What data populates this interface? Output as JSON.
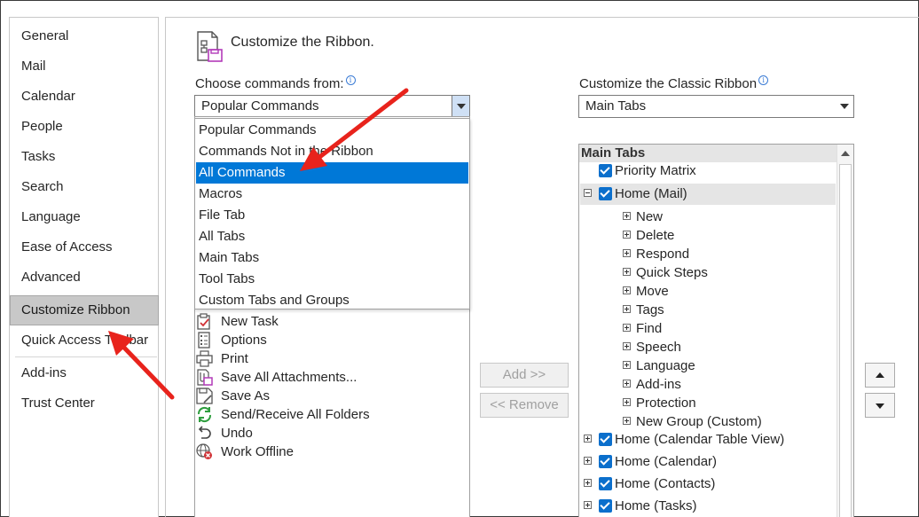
{
  "sidebar": {
    "items": [
      {
        "label": "General"
      },
      {
        "label": "Mail"
      },
      {
        "label": "Calendar"
      },
      {
        "label": "People"
      },
      {
        "label": "Tasks"
      },
      {
        "label": "Search"
      },
      {
        "label": "Language"
      },
      {
        "label": "Ease of Access"
      },
      {
        "label": "Advanced"
      },
      {
        "label": "Customize Ribbon"
      },
      {
        "label": "Quick Access Toolbar"
      },
      {
        "label": "Add-ins"
      },
      {
        "label": "Trust Center"
      }
    ],
    "selected": "Customize Ribbon"
  },
  "header": {
    "title": "Customize the Ribbon."
  },
  "choose_commands": {
    "label": "Choose commands from:",
    "value": "Popular Commands",
    "options": [
      "Popular Commands",
      "Commands Not in the Ribbon",
      "All Commands",
      "Macros",
      "File Tab",
      "All Tabs",
      "Main Tabs",
      "Tool Tabs",
      "Custom Tabs and Groups"
    ],
    "highlighted": "All Commands"
  },
  "commands_list": [
    {
      "label": "New Task",
      "icon": "new-task-icon"
    },
    {
      "label": "Options",
      "icon": "options-icon"
    },
    {
      "label": "Print",
      "icon": "printer-icon"
    },
    {
      "label": "Save All Attachments...",
      "icon": "attachments-icon"
    },
    {
      "label": "Save As",
      "icon": "save-as-icon"
    },
    {
      "label": "Send/Receive All Folders",
      "icon": "sync-icon"
    },
    {
      "label": "Undo",
      "icon": "undo-icon"
    },
    {
      "label": "Work Offline",
      "icon": "offline-globe-icon"
    }
  ],
  "buttons": {
    "add": "Add >>",
    "remove": "<< Remove"
  },
  "customize_ribbon": {
    "label": "Customize the Classic Ribbon",
    "value": "Main Tabs"
  },
  "tree": {
    "header": "Main Tabs",
    "items": [
      {
        "label": "Priority Matrix"
      },
      {
        "label": "Home (Mail)"
      },
      {
        "label": "New"
      },
      {
        "label": "Delete"
      },
      {
        "label": "Respond"
      },
      {
        "label": "Quick Steps"
      },
      {
        "label": "Move"
      },
      {
        "label": "Tags"
      },
      {
        "label": "Find"
      },
      {
        "label": "Speech"
      },
      {
        "label": "Language"
      },
      {
        "label": "Add-ins"
      },
      {
        "label": "Protection"
      },
      {
        "label": "New Group (Custom)"
      },
      {
        "label": "Home (Calendar Table View)"
      },
      {
        "label": "Home (Calendar)"
      },
      {
        "label": "Home (Contacts)"
      },
      {
        "label": "Home (Tasks)"
      }
    ]
  },
  "colors": {
    "selection": "#0078d7",
    "checkbox": "#0b6fcc",
    "annotation_arrow": "#e8231c"
  }
}
